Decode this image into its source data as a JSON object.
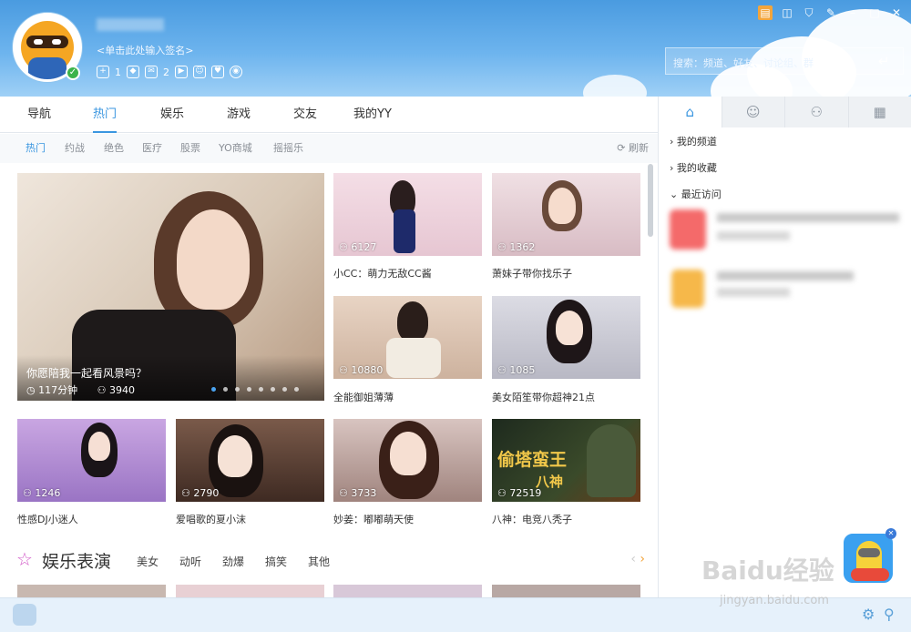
{
  "header": {
    "signature": "<单击此处输入签名>",
    "status_counts": [
      "1",
      "2"
    ],
    "search_placeholder": "搜索：频道、好友、讨论组、群"
  },
  "main_tabs": [
    "导航",
    "热门",
    "娱乐",
    "游戏",
    "交友",
    "我的YY"
  ],
  "active_main_tab": "热门",
  "sub_tabs": [
    "热门",
    "约战",
    "绝色",
    "医疗",
    "股票",
    "YO商城",
    "摇摇乐"
  ],
  "refresh_label": "刷新",
  "featured": {
    "title": "你愿陪我一起看风景吗？",
    "duration": "117分钟",
    "viewers": "3940"
  },
  "carousel_dots": 8,
  "grid": [
    {
      "count": "6127",
      "caption": "小CC：萌力无敌CC酱"
    },
    {
      "count": "1362",
      "caption": "萧妹子带你找乐子"
    },
    {
      "count": "10880",
      "caption": "全能御姐薄薄"
    },
    {
      "count": "1085",
      "caption": "美女陌笙带你超神21点"
    },
    {
      "count": "1246",
      "caption": "性感DJ小迷人"
    },
    {
      "count": "2790",
      "caption": "爱唱歌的夏小沫"
    },
    {
      "count": "3733",
      "caption": "妙姜：嘟嘟萌天使"
    },
    {
      "count": "72519",
      "caption": "八神：电竞八秃子"
    }
  ],
  "game_banner": {
    "title": "偷塔蛮王",
    "subtitle": "八神"
  },
  "entertainment": {
    "title": "娱乐表演",
    "tags": [
      "美女",
      "动听",
      "劲爆",
      "搞笑",
      "其他"
    ]
  },
  "right_panel": {
    "tree": [
      "我的频道",
      "我的收藏",
      "最近访问"
    ]
  },
  "watermark": {
    "brand": "Baidu经验",
    "url": "jingyan.baidu.com"
  },
  "colors": {
    "accent": "#3a96e0",
    "header": "#5aa8e8"
  }
}
